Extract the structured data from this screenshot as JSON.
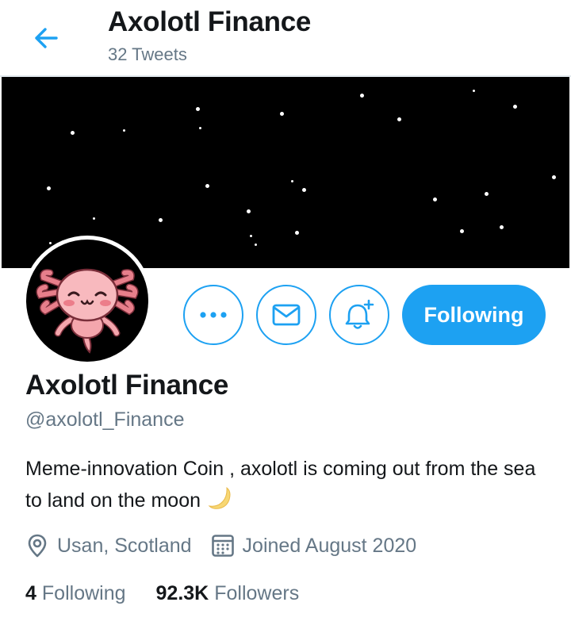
{
  "header": {
    "title": "Axolotl Finance",
    "subtitle": "32 Tweets",
    "back_icon": "arrow-left-icon"
  },
  "actions": {
    "more_icon": "more-horizontal-icon",
    "message_icon": "envelope-icon",
    "notify_icon": "bell-plus-icon",
    "follow_label": "Following"
  },
  "profile": {
    "display_name": "Axolotl Finance",
    "handle": "@axolotl_Finance",
    "bio": "Meme-innovation Coin , axolotl is coming out from the sea to land on the moon",
    "bio_emoji_icon": "crescent-moon-icon",
    "location": "Usan, Scotland",
    "location_icon": "location-pin-icon",
    "joined": "Joined August 2020",
    "joined_icon": "calendar-icon"
  },
  "stats": {
    "following_count": "4",
    "following_label": "Following",
    "followers_count": "92.3K",
    "followers_label": "Followers"
  },
  "colors": {
    "accent": "#1da1f2",
    "text_primary": "#14171a",
    "text_secondary": "#657786",
    "banner": "#000000"
  }
}
